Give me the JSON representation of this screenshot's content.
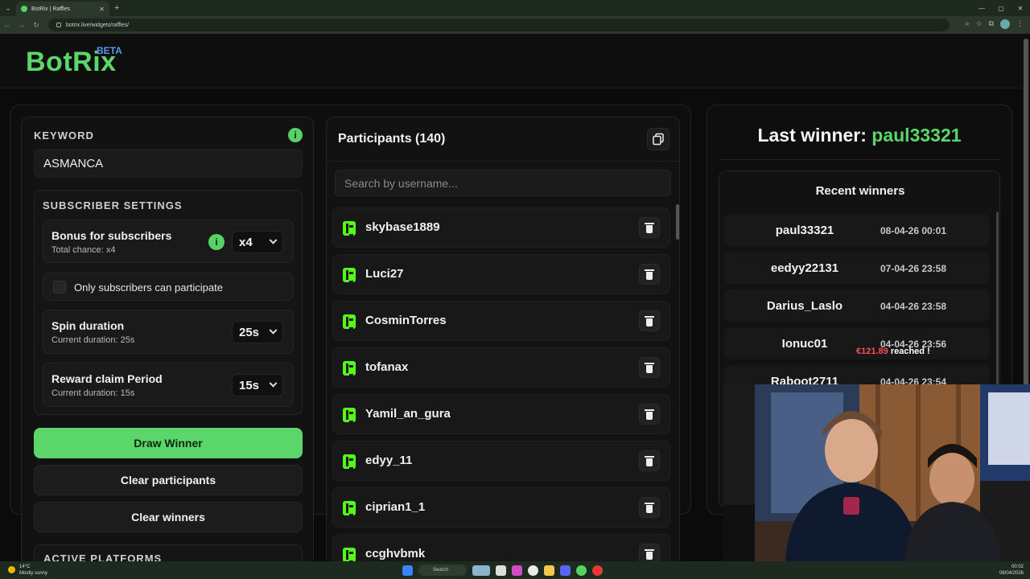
{
  "browser": {
    "tab_title": "BotRix | Raffles",
    "url": "botrix.live/widgets/raffles/"
  },
  "header": {
    "logo": "BotRix",
    "badge": "BETA"
  },
  "settings": {
    "keyword_label": "KEYWORD",
    "keyword_value": "ASMANCA",
    "info_glyph": "i",
    "subscriber_label": "SUBSCRIBER SETTINGS",
    "bonus_title": "Bonus for subscribers",
    "bonus_sub": "Total chance: x4",
    "bonus_value": "x4",
    "only_subs_label": "Only subscribers can participate",
    "spin_title": "Spin duration",
    "spin_sub": "Current duration: 25s",
    "spin_value": "25s",
    "reward_title": "Reward claim Period",
    "reward_sub": "Current duration: 15s",
    "reward_value": "15s",
    "draw_label": "Draw Winner",
    "clear_participants_label": "Clear participants",
    "clear_winners_label": "Clear winners",
    "active_platforms_label": "ACTIVE PLATFORMS"
  },
  "participants": {
    "title": "Participants (140)",
    "search_placeholder": "Search by username...",
    "items": [
      "skybase1889",
      "Luci27",
      "CosminTorres",
      "tofanax",
      "Yamil_an_gura",
      "edyy_11",
      "ciprian1_1",
      "ccghvbmk"
    ]
  },
  "winners": {
    "last_label": "Last winner:",
    "last_name": "paul33321",
    "recent_title": "Recent winners",
    "items": [
      {
        "name": "paul33321",
        "date": "08-04-26 00:01"
      },
      {
        "name": "eedyy22131",
        "date": "07-04-26 23:58"
      },
      {
        "name": "Darius_Laslo",
        "date": "04-04-26 23:58"
      },
      {
        "name": "Ionuc01",
        "date": "04-04-26 23:56"
      },
      {
        "name": "Raboot2711",
        "date": "04-04-26 23:54"
      }
    ],
    "alert_amount": "€121.89",
    "alert_text": "reached !"
  },
  "taskbar": {
    "temp": "14°C",
    "weather": "Mostly sunny",
    "search": "Search",
    "time": "00:02",
    "date": "08/04/2026"
  },
  "colors": {
    "accent": "#5ad66a",
    "kick": "#53fc18",
    "beta": "#5c9ae8"
  }
}
